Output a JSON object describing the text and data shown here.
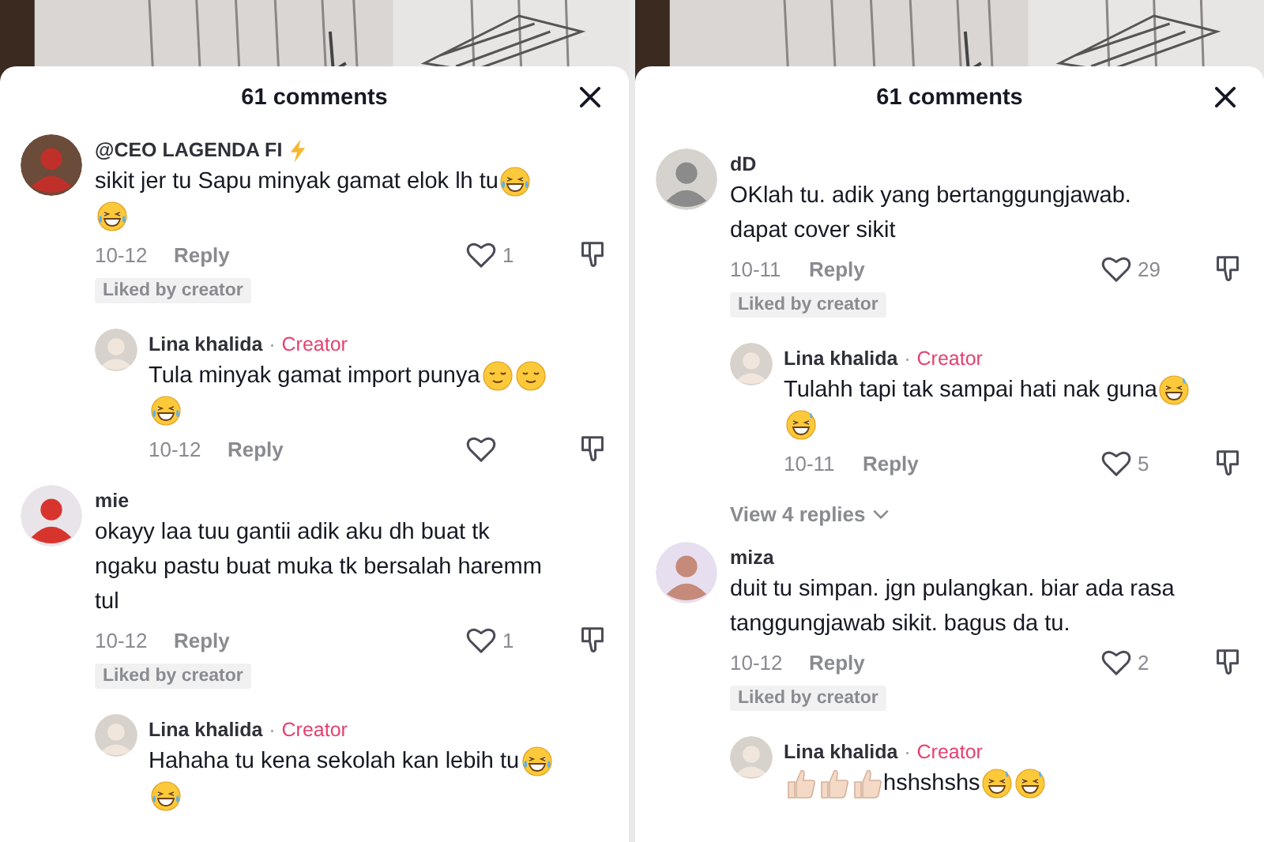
{
  "panels": [
    {
      "title": "61 comments",
      "comments": [
        {
          "author": "@CEO LAGENDA FI",
          "author_icon": {
            "kind": "lightning"
          },
          "lines": [
            [
              {
                "kind": "text",
                "text": "sikit jer tu Sapu minyak gamat elok lh tu"
              },
              {
                "kind": "joy"
              }
            ],
            [
              {
                "kind": "joy"
              }
            ]
          ],
          "date": "10-12",
          "reply": "Reply",
          "likes": "1",
          "liked_label": "Liked by creator",
          "replies": [
            {
              "author": "Lina khalida",
              "separator": "·",
              "tag": "Creator",
              "lines": [
                [
                  {
                    "kind": "text",
                    "text": "Tula minyak gamat import punya"
                  },
                  {
                    "kind": "relieved"
                  },
                  {
                    "kind": "relieved"
                  }
                ],
                [
                  {
                    "kind": "rofl"
                  }
                ]
              ],
              "date": "10-12",
              "reply": "Reply"
            }
          ]
        },
        {
          "author": "mie",
          "lines": [
            [
              {
                "kind": "text",
                "text": "okayy laa tuu gantii adik aku dh buat tk"
              }
            ],
            [
              {
                "kind": "text",
                "text": "ngaku pastu buat muka tk bersalah haremm"
              }
            ],
            [
              {
                "kind": "text",
                "text": "tul"
              }
            ]
          ],
          "date": "10-12",
          "reply": "Reply",
          "likes": "1",
          "liked_label": "Liked by creator",
          "replies": [
            {
              "author": "Lina khalida",
              "separator": "·",
              "tag": "Creator",
              "lines": [
                [
                  {
                    "kind": "text",
                    "text": "Hahaha tu kena sekolah kan lebih tu"
                  },
                  {
                    "kind": "rofl"
                  }
                ],
                [
                  {
                    "kind": "rofl"
                  }
                ]
              ]
            }
          ]
        }
      ]
    },
    {
      "title": "61 comments",
      "comments": [
        {
          "author": "dD",
          "lines": [
            [
              {
                "kind": "text",
                "text": "OKlah tu. adik yang bertanggungjawab."
              }
            ],
            [
              {
                "kind": "text",
                "text": "dapat cover sikit"
              }
            ]
          ],
          "date": "10-11",
          "reply": "Reply",
          "likes": "29",
          "liked_label": "Liked by creator",
          "replies": [
            {
              "author": "Lina khalida",
              "separator": "·",
              "tag": "Creator",
              "lines": [
                [
                  {
                    "kind": "text",
                    "text": "Tulahh tapi tak sampai hati nak guna"
                  },
                  {
                    "kind": "sweat"
                  }
                ],
                [
                  {
                    "kind": "sweat"
                  }
                ]
              ],
              "date": "10-11",
              "reply": "Reply",
              "likes": "5"
            }
          ],
          "view_replies": "View 4 replies"
        },
        {
          "author": "miza",
          "lines": [
            [
              {
                "kind": "text",
                "text": "duit tu simpan. jgn pulangkan. biar ada rasa"
              }
            ],
            [
              {
                "kind": "text",
                "text": "tanggungjawab sikit. bagus da tu."
              }
            ]
          ],
          "date": "10-12",
          "reply": "Reply",
          "likes": "2",
          "liked_label": "Liked by creator",
          "replies": [
            {
              "author": "Lina khalida",
              "separator": "·",
              "tag": "Creator",
              "lines": [
                [
                  {
                    "kind": "thumbs"
                  },
                  {
                    "kind": "thumbs"
                  },
                  {
                    "kind": "thumbs"
                  },
                  {
                    "kind": "text",
                    "text": " hshshshs"
                  },
                  {
                    "kind": "sweat"
                  },
                  {
                    "kind": "sweat"
                  }
                ]
              ]
            }
          ]
        }
      ]
    }
  ]
}
